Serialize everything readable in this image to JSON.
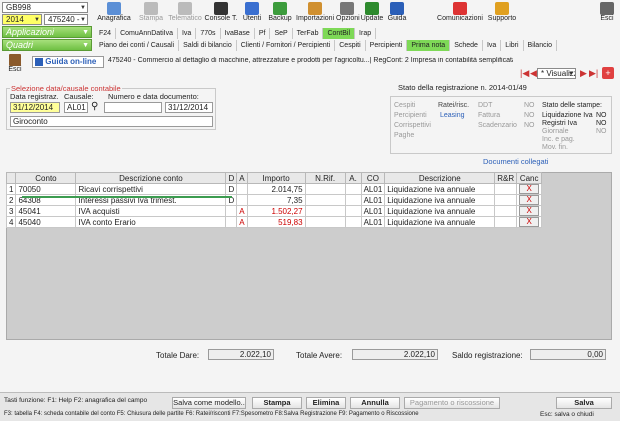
{
  "top": {
    "company_code": "GB998",
    "year": "2014",
    "company_num": "475240 -",
    "apps_label": "Applicazioni",
    "quadri_label": "Quadri"
  },
  "toolbar": [
    {
      "label": "Anagrafica",
      "name": "anagrafica",
      "color": "#5b8fd6",
      "disabled": false
    },
    {
      "label": "Stampa",
      "name": "stampa",
      "color": "#bbb",
      "disabled": true
    },
    {
      "label": "Telematico",
      "name": "telematico",
      "color": "#bbb",
      "disabled": true
    },
    {
      "label": "Console T.",
      "name": "console",
      "color": "#333",
      "disabled": false
    },
    {
      "label": "Utenti",
      "name": "utenti",
      "color": "#3a6fd0",
      "disabled": false
    },
    {
      "label": "Backup",
      "name": "backup",
      "color": "#3c9c3c",
      "disabled": false
    },
    {
      "label": "Importazioni",
      "name": "importazioni",
      "color": "#d09030",
      "disabled": false
    },
    {
      "label": "Opzioni",
      "name": "opzioni",
      "color": "#777",
      "disabled": false
    },
    {
      "label": "Update",
      "name": "update",
      "color": "#2d8a2d",
      "disabled": false
    },
    {
      "label": "Guida",
      "name": "guida",
      "color": "#2b5fb8",
      "disabled": false
    },
    {
      "label": "Comunicazioni",
      "name": "comunicazioni",
      "color": "#d33",
      "disabled": false
    },
    {
      "label": "Supporto",
      "name": "supporto",
      "color": "#e0a020",
      "disabled": false
    },
    {
      "label": "Esci",
      "name": "esci-top",
      "color": "#666",
      "disabled": false
    }
  ],
  "menu1": [
    "F24",
    "ComuAnnDatiIva",
    "Iva",
    "770s",
    "IvaBase",
    "Pf",
    "SeP",
    "TerFab",
    "ContBil",
    "Irap"
  ],
  "menu1_active": "ContBil",
  "menu2": [
    "Piano dei conti / Causali",
    "Saldi di bilancio",
    "Clienti / Fornitori / Percipienti",
    "Cespiti",
    "Percipienti",
    "Prima nota",
    "Schede",
    "Iva",
    "Libri",
    "Bilancio"
  ],
  "menu2_active": "Prima nota",
  "subbar": {
    "esci": "Esci",
    "guida_online": "Guida on-line",
    "info": "475240 - Commercio al dettaglio di macchine, attrezzature e prodotti per l'agricoltu...| RegCont: 2 Impresa in contabilità semplificata...",
    "visualizza": "* Visualizz"
  },
  "selezione": {
    "legend": "Selezione data/causale contabile",
    "data_label": "Data registraz.",
    "causale_label": "Causale:",
    "numero_label": "Numero e data documento:",
    "data_value": "31/12/2014",
    "causale_value": "AL01",
    "numero_value": "",
    "data_doc_value": "31/12/2014",
    "descrizione": "Giroconto"
  },
  "stato": {
    "title": "Stato della registrazione n. 2014-01/49",
    "col1": [
      "Cespiti",
      "Percipienti",
      "Corrispettivi",
      "Paghe"
    ],
    "col2_head": "Ratei/risc.",
    "col2_val": "Leasing",
    "col3": [
      "DDT",
      "Fattura",
      "Scadenzario"
    ],
    "col3_vals": [
      "NO",
      "NO",
      "NO"
    ],
    "stampe_title": "Stato delle stampe:",
    "stampe": [
      {
        "label": "Liquidazione Iva",
        "value": "NO",
        "dim": false
      },
      {
        "label": "Registri Iva",
        "value": "NO",
        "dim": false
      },
      {
        "label": "Giornale",
        "value": "NO",
        "dim": true
      },
      {
        "label": "Inc. e pag.",
        "value": "",
        "dim": true
      },
      {
        "label": "Mov. fin.",
        "value": "",
        "dim": true
      }
    ],
    "documenti_collegati": "Documenti collegati"
  },
  "grid": {
    "headers": [
      "",
      "Conto",
      "Descrizione conto",
      "D",
      "A",
      "Importo",
      "N.Rif.",
      "A.",
      "CO",
      "Descrizione",
      "R&R",
      "Canc"
    ],
    "rows": [
      {
        "n": "1",
        "conto": "70050",
        "desc": "Ricavi corrispettivi",
        "d": "D",
        "a": "",
        "importo": "2.014,75",
        "red": false,
        "co": "AL01",
        "descrizione": "Liquidazione iva annuale"
      },
      {
        "n": "2",
        "conto": "64308",
        "desc": "Interessi passivi Iva trimest.",
        "d": "D",
        "a": "",
        "importo": "7,35",
        "red": false,
        "co": "AL01",
        "descrizione": "Liquidazione iva annuale"
      },
      {
        "n": "3",
        "conto": "45041",
        "desc": "IVA acquisti",
        "d": "",
        "a": "A",
        "importo": "1.502,27",
        "red": true,
        "co": "AL01",
        "descrizione": "Liquidazione iva annuale"
      },
      {
        "n": "4",
        "conto": "45040",
        "desc": "IVA conto Erario",
        "d": "",
        "a": "A",
        "importo": "519,83",
        "red": true,
        "co": "AL01",
        "descrizione": "Liquidazione iva annuale"
      }
    ],
    "canc": "X"
  },
  "totals": {
    "dare_label": "Totale Dare:",
    "dare_value": "2.022,10",
    "avere_label": "Totale Avere:",
    "avere_value": "2.022,10",
    "saldo_label": "Saldo registrazione:",
    "saldo_value": "0,00"
  },
  "footer": {
    "line1": "Tasti funzione: F1: Help  F2: anagrafica del campo",
    "line2": "F3: tabella  F4: scheda contabile del conto  F5: Chiusura delle partite    F6: Ratei/risconti  F7:Spesometro  F8:Salva Registrazione   F9: Pagamento o Riscossione",
    "esc": "Esc: salva o chiudi",
    "btn_salva_modello": "Salva come modello..",
    "btn_stampa": "Stampa",
    "btn_elimina": "Elimina",
    "btn_annulla": "Annulla",
    "btn_pagamento": "Pagamento o riscossione",
    "btn_salva": "Salva"
  }
}
